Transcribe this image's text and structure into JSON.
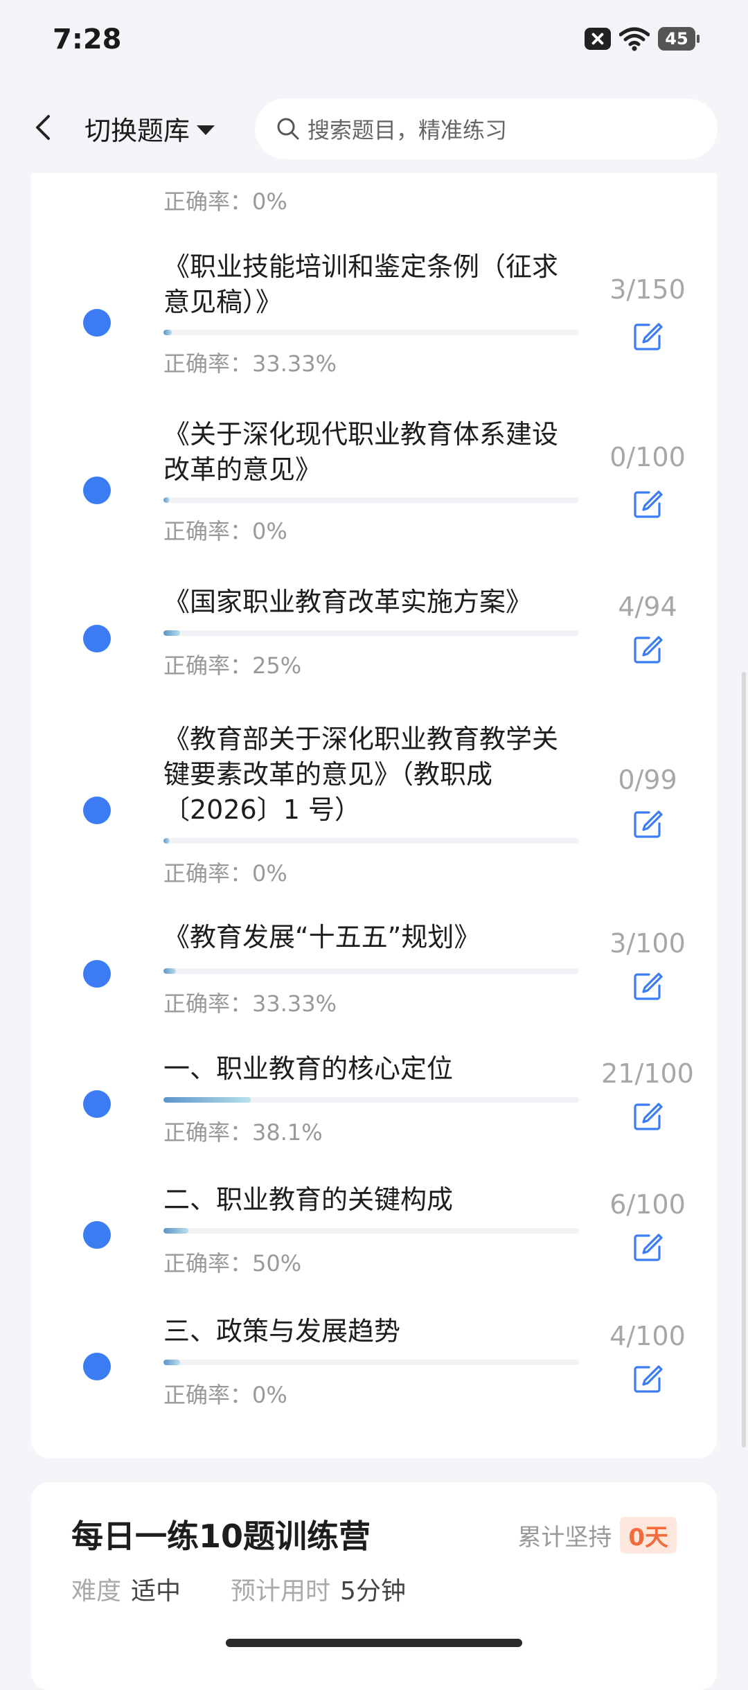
{
  "status": {
    "time": "7:28",
    "battery": "45"
  },
  "header": {
    "switch_label": "切换题库",
    "search_placeholder": "搜索题目，精准练习"
  },
  "items": [
    {
      "title": "",
      "accuracy": "正确率：0%",
      "count": "",
      "progress": 0.07
    },
    {
      "title": "《职业技能培训和鉴定条例（征求意见稿）》",
      "accuracy": "正确率：33.33%",
      "count": "3/150",
      "progress": 0.02
    },
    {
      "title": "《关于深化现代职业教育体系建设改革的意见》",
      "accuracy": "正确率：0%",
      "count": "0/100",
      "progress": 0.0
    },
    {
      "title": "《国家职业教育改革实施方案》",
      "accuracy": "正确率：25%",
      "count": "4/94",
      "progress": 0.04
    },
    {
      "title": "《教育部关于深化职业教育教学关键要素改革的意见》（教职成〔2026〕1 号）",
      "accuracy": "正确率：0%",
      "count": "0/99",
      "progress": 0.0
    },
    {
      "title": "《教育发展“十五五”规划》",
      "accuracy": "正确率：33.33%",
      "count": "3/100",
      "progress": 0.03
    },
    {
      "title": "一、职业教育的核心定位",
      "accuracy": "正确率：38.1%",
      "count": "21/100",
      "progress": 0.21
    },
    {
      "title": "二、职业教育的关键构成",
      "accuracy": "正确率：50%",
      "count": "6/100",
      "progress": 0.06
    },
    {
      "title": "三、政策与发展趋势",
      "accuracy": "正确率：0%",
      "count": "4/100",
      "progress": 0.04
    }
  ],
  "daily": {
    "title": "每日一练10题训练营",
    "streak_label": "累计坚持",
    "streak_value": "0天",
    "difficulty_label": "难度",
    "difficulty_value": "适中",
    "time_label": "预计用时",
    "time_value": "5分钟"
  }
}
